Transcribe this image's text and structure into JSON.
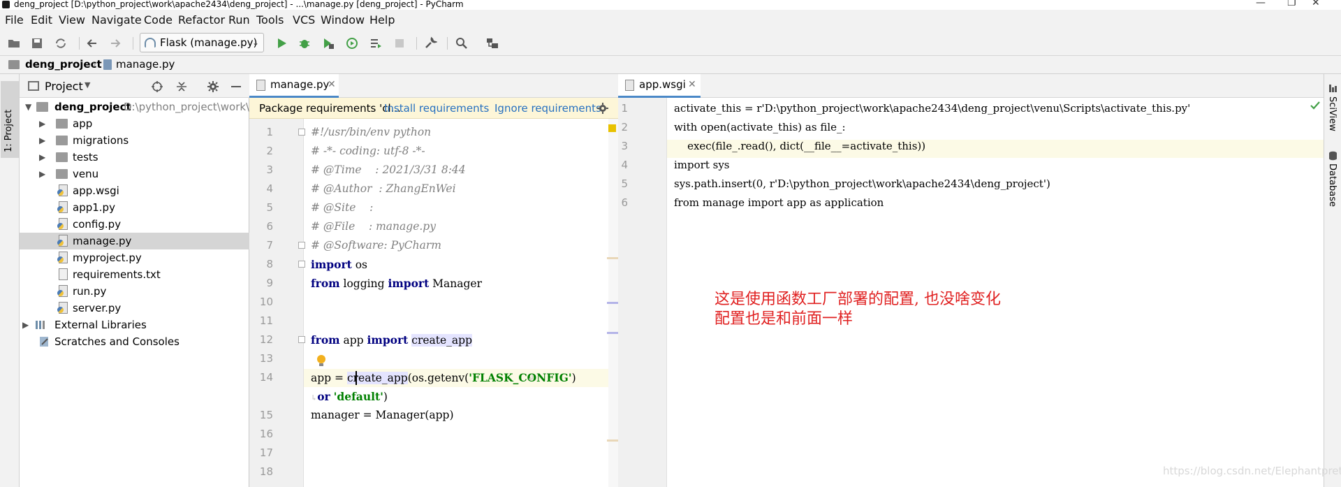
{
  "window": {
    "title": "deng_project [D:\\python_project\\work\\apache2434\\deng_project] - ...\\manage.py [deng_project] - PyCharm",
    "controls": [
      "—",
      "❐",
      "✕"
    ]
  },
  "menu": [
    "File",
    "Edit",
    "View",
    "Navigate",
    "Code",
    "Refactor",
    "Run",
    "Tools",
    "VCS",
    "Window",
    "Help"
  ],
  "toolbar": {
    "run_config": "Flask (manage.py)"
  },
  "breadcrumb": {
    "project": "deng_project",
    "file": "manage.py"
  },
  "left_stripe": {
    "tab": "1: Project"
  },
  "project_panel": {
    "title": "Project",
    "root": {
      "name": "deng_project",
      "path": "D:\\python_project\\work\\ap"
    },
    "items": [
      {
        "label": "app"
      },
      {
        "label": "migrations"
      },
      {
        "label": "tests"
      },
      {
        "label": "venu"
      },
      {
        "label": "app.wsgi"
      },
      {
        "label": "app1.py"
      },
      {
        "label": "config.py"
      },
      {
        "label": "manage.py"
      },
      {
        "label": "myproject.py"
      },
      {
        "label": "requirements.txt"
      },
      {
        "label": "run.py"
      },
      {
        "label": "server.py"
      },
      {
        "label": "External Libraries"
      },
      {
        "label": "Scratches and Consoles"
      }
    ]
  },
  "editor_left": {
    "tab": "manage.py",
    "banner": {
      "text": "Package requirements 'cl...",
      "install": "Install requirements",
      "ignore": "Ignore requirements"
    },
    "line_numbers": [
      "1",
      "2",
      "3",
      "4",
      "5",
      "6",
      "7",
      "8",
      "9",
      "10",
      "11",
      "12",
      "13",
      "14",
      "",
      "15",
      "16",
      "17",
      "18"
    ],
    "code": {
      "l1": "#!/usr/bin/env python",
      "l2": "# -*- coding: utf-8 -*-",
      "l3": "# @Time    : 2021/3/31 8:44",
      "l4": "# @Author  : ZhangEnWei",
      "l5": "# @Site    :",
      "l6": "# @File    : manage.py",
      "l7": "# @Software: PyCharm",
      "l8_kw": "import",
      "l8_rest": " os",
      "l9_from": "from",
      "l9_mod": " logging ",
      "l9_import": "import",
      "l9_rest": " Manager",
      "l12_from": "from",
      "l12_mod": " app ",
      "l12_import": "import",
      "l12_fn": "create_app",
      "l14_a": "app = ",
      "l14_fn": "create_app",
      "l14_b": "(os.getenv(",
      "l14_str": "'FLASK_CONFIG'",
      "l14_c": ")",
      "l14w_or": "or",
      "l14w_str": "'default'",
      "l14w_c": ")",
      "l15": "manager = Manager(app)"
    }
  },
  "editor_right": {
    "tab": "app.wsgi",
    "line_numbers": [
      "1",
      "2",
      "3",
      "4",
      "5",
      "6"
    ],
    "lines": [
      "activate_this = r'D:\\python_project\\work\\apache2434\\deng_project\\venu\\Scripts\\activate_this.py'",
      "with open(activate_this) as file_:",
      "    exec(file_.read(), dict(__file__=activate_this))",
      "import sys",
      "sys.path.insert(0, r'D:\\python_project\\work\\apache2434\\deng_project')",
      "from manage import app as application"
    ]
  },
  "right_stripe": {
    "tabs": [
      "SciView",
      "Database"
    ]
  },
  "annotation": {
    "line1": "这是使用函数工厂部署的配置, 也没啥变化",
    "line2": "配置也是和前面一样"
  },
  "watermark": "https://blog.csdn.net/Elephantpretty"
}
